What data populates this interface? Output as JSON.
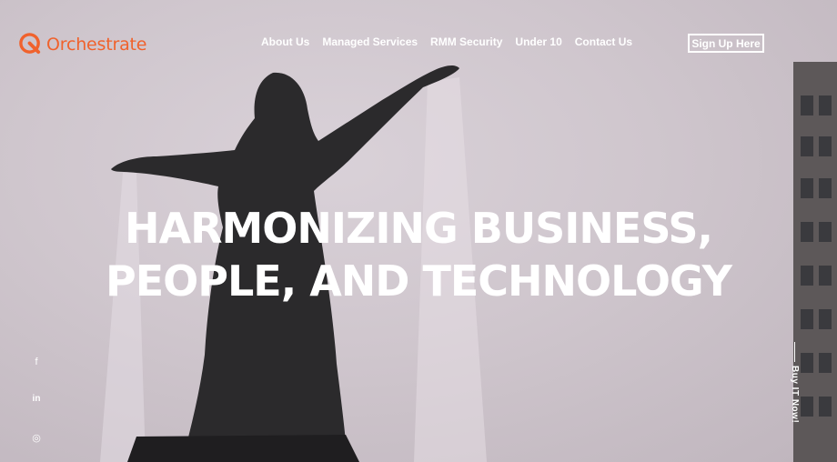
{
  "brand": {
    "name": "Orchestrate",
    "accent": "#f0622d"
  },
  "nav": {
    "items": [
      {
        "label": "About Us"
      },
      {
        "label": "Managed Services"
      },
      {
        "label": "RMM Security"
      },
      {
        "label": "Under 10"
      },
      {
        "label": "Contact Us"
      }
    ],
    "signup_label": "Sign Up Here"
  },
  "hero": {
    "headline_line1": "HARMONIZING BUSINESS,",
    "headline_line2": "PEOPLE, AND TECHNOLOGY"
  },
  "social": [
    {
      "icon": "facebook-icon",
      "glyph": "f"
    },
    {
      "icon": "linkedin-icon",
      "glyph": "in"
    },
    {
      "icon": "instagram-icon",
      "glyph": "◎"
    }
  ],
  "side_cta": {
    "label": "Buy IT Now!"
  }
}
